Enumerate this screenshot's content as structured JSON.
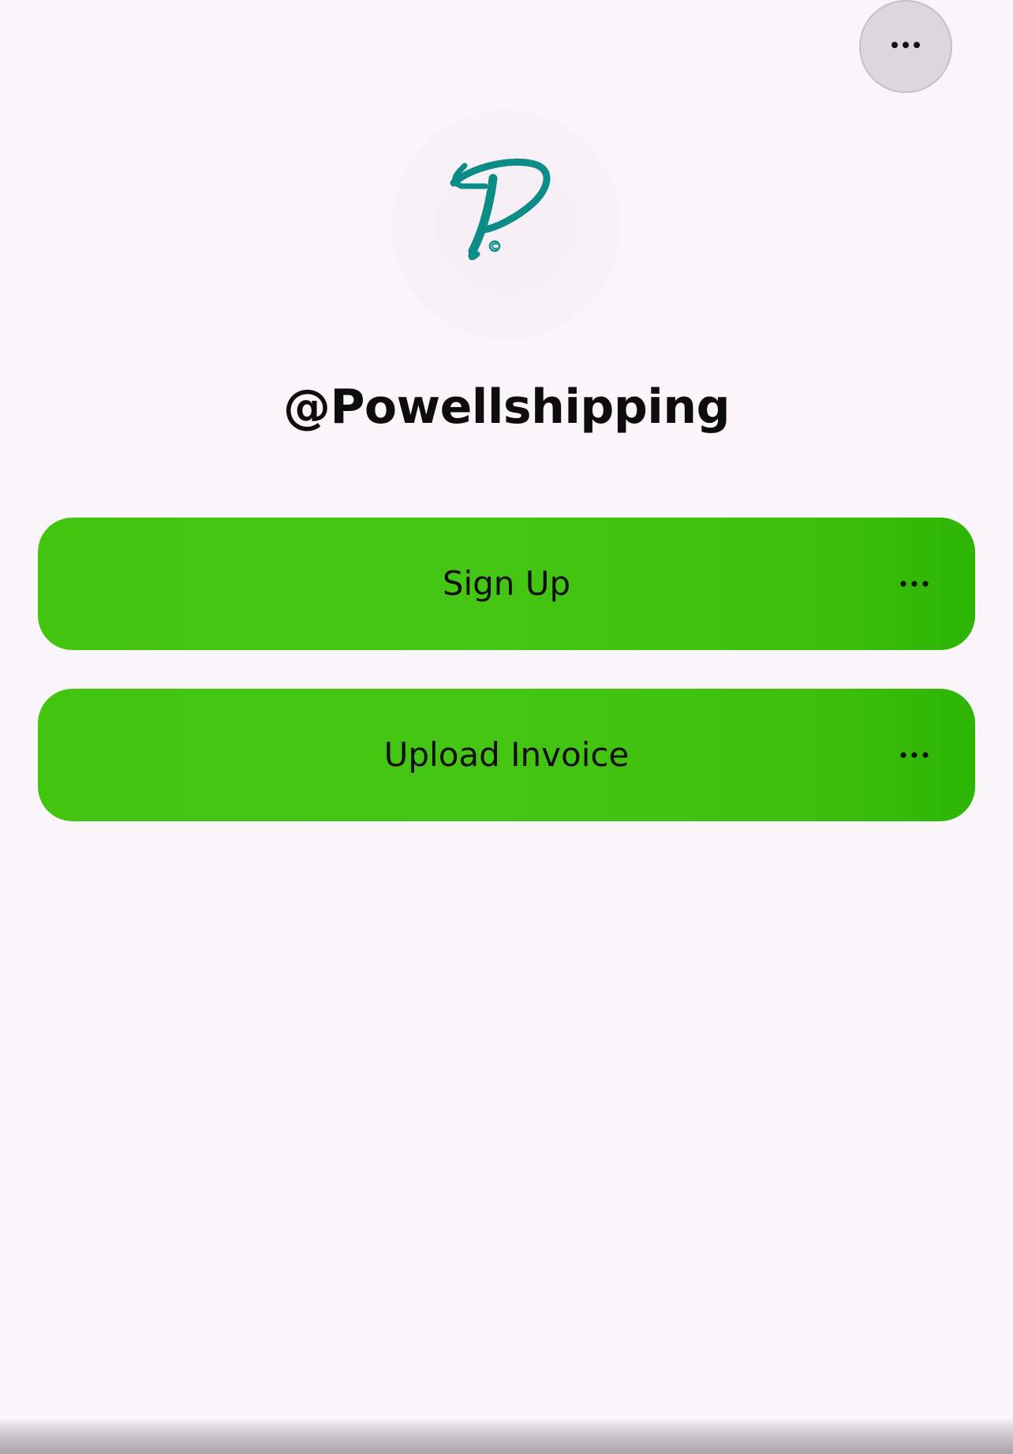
{
  "header": {
    "more_icon": "ellipsis-icon"
  },
  "profile": {
    "avatar_icon": "cursive-p-logo",
    "logo_color": "#0b8c86",
    "handle": "@Powellshipping"
  },
  "links": [
    {
      "label": "Sign Up",
      "more_icon": "ellipsis-icon"
    },
    {
      "label": "Upload Invoice",
      "more_icon": "ellipsis-icon"
    }
  ],
  "theme": {
    "background": "#f9f5f9",
    "button_color": "#43c40f",
    "text_color": "#0e0e0e"
  }
}
